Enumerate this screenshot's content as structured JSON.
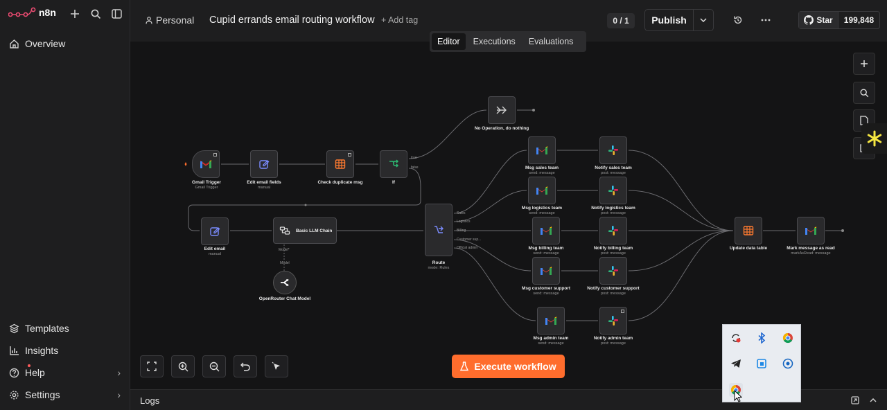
{
  "app": {
    "name": "n8n"
  },
  "sidebar": {
    "overview": "Overview",
    "templates": "Templates",
    "insights": "Insights",
    "help": "Help",
    "settings": "Settings"
  },
  "header": {
    "project": "Personal",
    "title": "Cupid errands email routing workflow",
    "add_tag": "+ Add tag",
    "counter": "0 / 1",
    "publish": "Publish",
    "star": "Star",
    "star_count": "199,848"
  },
  "tabs": [
    "Editor",
    "Executions",
    "Evaluations"
  ],
  "nodes": {
    "gmail_trigger": {
      "label": "Gmail Trigger",
      "sub": "Gmail Trigger"
    },
    "edit_fields": {
      "label": "Edit email fields",
      "sub": "manual"
    },
    "check_dup": {
      "label": "Check duplicate msg",
      "sub": ""
    },
    "if": {
      "label": "If",
      "sub": ""
    },
    "noop": {
      "label": "No Operation, do nothing",
      "sub": ""
    },
    "edit_email": {
      "label": "Edit email",
      "sub": "manual"
    },
    "llm": {
      "label": "Basic LLM Chain"
    },
    "model_port": "Model*",
    "model_port2": "Model",
    "openrouter": {
      "label": "OpenRouter Chat Model"
    },
    "route": {
      "label": "Route",
      "sub": "mode: Rules"
    },
    "if_true": "true",
    "if_false": "false",
    "route_outputs": [
      "Sales",
      "Logistics",
      "Billing",
      "Customer sup...",
      "Official admin"
    ],
    "msg_sales": {
      "label": "Msg sales team",
      "sub": "send: message"
    },
    "msg_logistics": {
      "label": "Msg logistics team",
      "sub": "send: message"
    },
    "msg_billing": {
      "label": "Msg billing team",
      "sub": "send: message"
    },
    "msg_support": {
      "label": "Msg customer support",
      "sub": "send: message"
    },
    "msg_admin": {
      "label": "Msg admin team",
      "sub": "send: message"
    },
    "notify_sales": {
      "label": "Notify sales team",
      "sub": "post: message"
    },
    "notify_logistics": {
      "label": "Notify logistics team",
      "sub": "post: message"
    },
    "notify_billing": {
      "label": "Notify billing team",
      "sub": "post: message"
    },
    "notify_support": {
      "label": "Notify customer support",
      "sub": "post: message"
    },
    "notify_admin": {
      "label": "Notify admin team",
      "sub": "post: message"
    },
    "update_table": {
      "label": "Update data table",
      "sub": ""
    },
    "mark_read": {
      "label": "Mark message as read",
      "sub": "markAsRead: message"
    }
  },
  "execute_button": "Execute workflow",
  "logs": "Logs",
  "colors": {
    "accent": "#ff6d2d",
    "canvas": "#141415",
    "sidebar": "#1e1e1f"
  }
}
